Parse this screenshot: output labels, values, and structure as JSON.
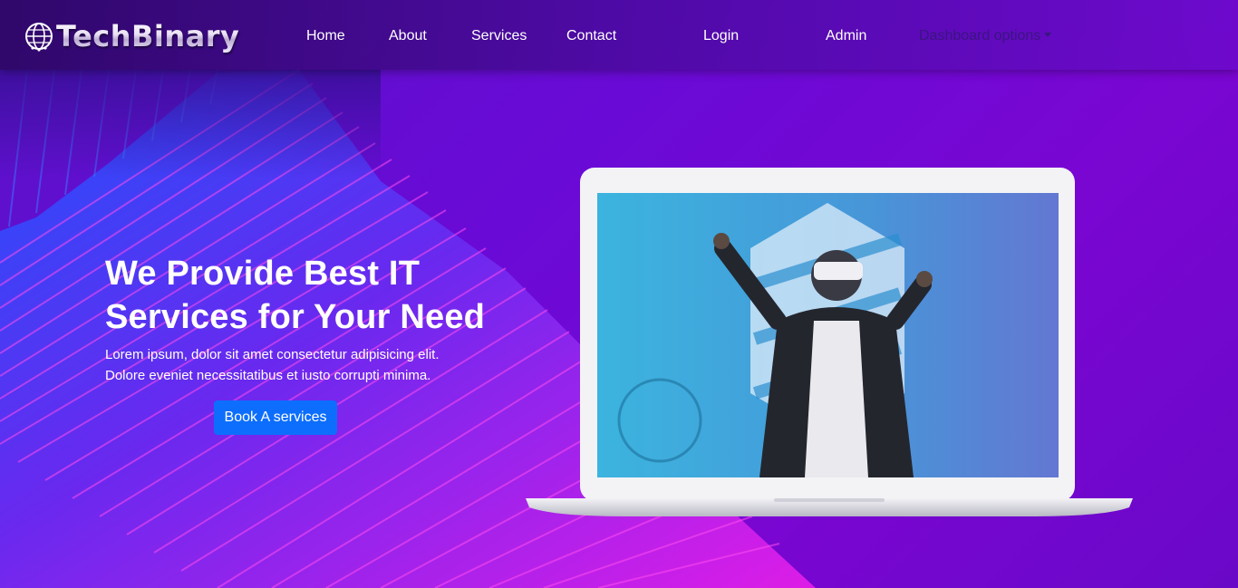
{
  "brand": {
    "name": "TechBinary",
    "icon": "globe-circuit-icon"
  },
  "nav": {
    "home": "Home",
    "about": "About",
    "services": "Services",
    "contact": "Contact",
    "login": "Login",
    "admin": "Admin",
    "dashboard": "Dashboard options"
  },
  "hero": {
    "title_line1": "We Provide Best IT",
    "title_line2": "Services for Your Need",
    "desc_line1": "Lorem ipsum, dolor sit amet consectetur adipisicing elit.",
    "desc_line2": "Dolore eveniet necessitatibus et iusto corrupti minima.",
    "cta_label": "Book A services",
    "illustration": "laptop-vr-user-image"
  },
  "colors": {
    "background": "#6a0ad6",
    "cta": "#0d6efd",
    "ribbon_blue": "#2a5bff",
    "ribbon_pink": "#d81ee6",
    "screen_tint": "#2aa8d8"
  }
}
